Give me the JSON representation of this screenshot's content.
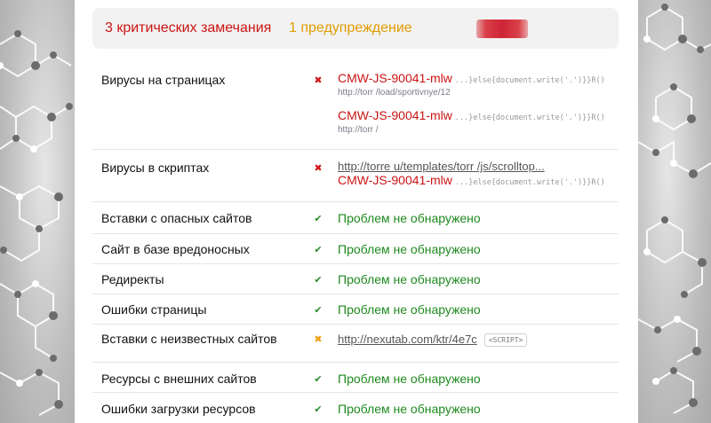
{
  "summary": {
    "critical": "3 критических замечания",
    "warning": "1 предупреждение"
  },
  "colors": {
    "critical": "#cc1414",
    "warning": "#e09b00",
    "ok": "#1f8a1f"
  },
  "rows": [
    {
      "label": "Вирусы на страницах",
      "status_icon": "cross-icon",
      "entries": [
        {
          "name": "CMW-JS-90041-mlw",
          "snippet": "...}else{document.write('.')}}R()",
          "url": "http://torr        /load/sportivnye/12"
        },
        {
          "name": "CMW-JS-90041-mlw",
          "snippet": "...}else{document.write('.')}}R()",
          "url": "http://torr        /"
        }
      ]
    },
    {
      "label": "Вирусы в скриптах",
      "status_icon": "cross-icon",
      "link": "http://torre      u/templates/torr       /js/scrolltop...",
      "name": "CMW-JS-90041-mlw",
      "snippet": "...}else{document.write('.')}}R()"
    },
    {
      "label": "Вставки с опасных сайтов",
      "status_icon": "check-icon",
      "value": "Проблем не обнаружено"
    },
    {
      "label": "Сайт в базе вредоносных",
      "status_icon": "check-icon",
      "value": "Проблем не обнаружено"
    },
    {
      "label": "Редиректы",
      "status_icon": "check-icon",
      "value": "Проблем не обнаружено"
    },
    {
      "label": "Ошибки страницы",
      "status_icon": "check-icon",
      "value": "Проблем не обнаружено"
    },
    {
      "label": "Вставки с неизвестных сайтов",
      "status_icon": "warning-cross-icon",
      "link": "http://nexutab.com/ktr/4e7c",
      "tag": "<SCRIPT>"
    },
    {
      "label": "Ресурсы с внешних сайтов",
      "status_icon": "check-icon",
      "value": "Проблем не обнаружено"
    },
    {
      "label": "Ошибки загрузки ресурсов",
      "status_icon": "check-icon",
      "value": "Проблем не обнаружено"
    }
  ]
}
